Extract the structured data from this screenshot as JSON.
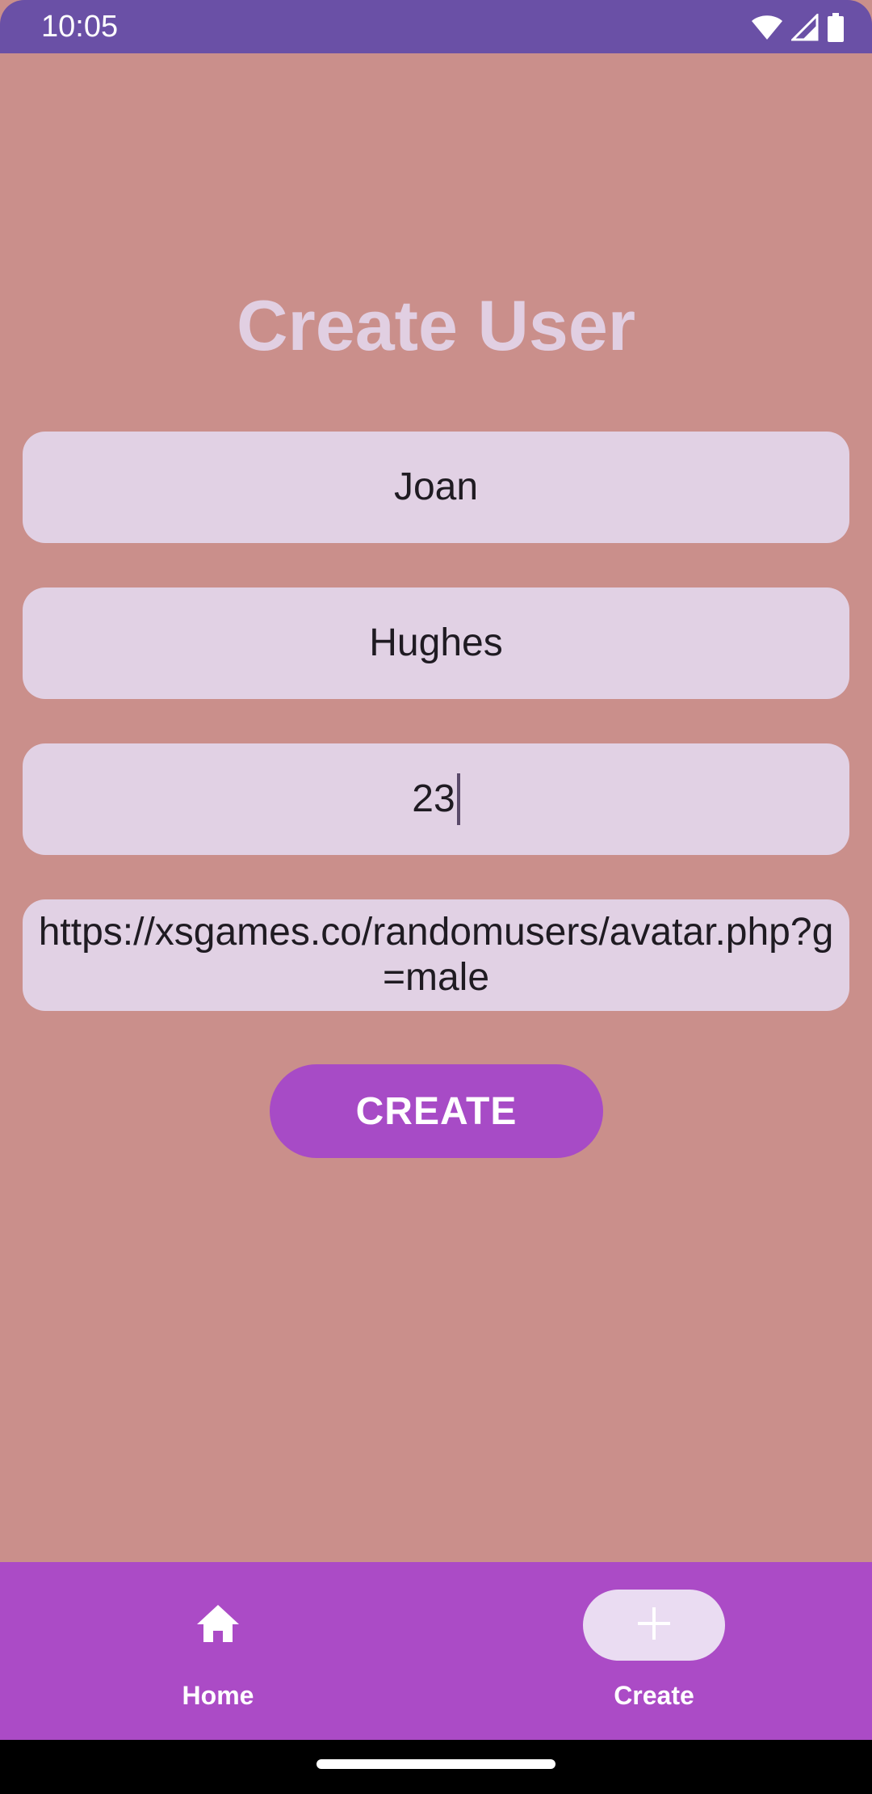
{
  "status_bar": {
    "time": "10:05",
    "icons": [
      "wifi-icon",
      "signal-icon",
      "battery-icon"
    ]
  },
  "screen": {
    "title": "Create User"
  },
  "form": {
    "first_name": "Joan",
    "last_name": "Hughes",
    "age": "23",
    "avatar_url": "https://xsgames.co/randomusers/avatar.php?g=male"
  },
  "actions": {
    "create_label": "CREATE"
  },
  "bottom_nav": {
    "items": [
      {
        "label": "Home",
        "icon": "home-icon",
        "selected": false
      },
      {
        "label": "Create",
        "icon": "plus-icon",
        "selected": true
      }
    ]
  },
  "colors": {
    "background": "#ca8f8b",
    "status_bar": "#6a50a6",
    "accent": "#ab4bc6",
    "field": "#e1d1e4",
    "title": "#e1cfe2"
  }
}
